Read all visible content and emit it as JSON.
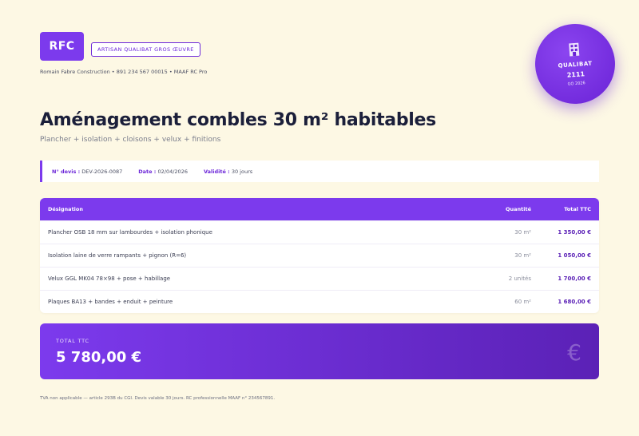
{
  "header": {
    "logo_text": "RFC",
    "qualification_badge": "ARTISAN QUALIBAT GROS ŒUVRE",
    "company_line": "Romain Fabre Construction • 891 234 567 00015 • MAAF RC Pro"
  },
  "seal": {
    "icon": "building-emblem-icon",
    "title": "QUALIBAT",
    "number": "2111",
    "subtitle": "GO 2026"
  },
  "document": {
    "title": "Aménagement combles 30 m² habitables",
    "subtitle": "Plancher + isolation + cloisons + velux + finitions"
  },
  "info": {
    "number_label": "N° devis :",
    "number_value": "DEV-2026-0087",
    "date_label": "Date :",
    "date_value": "02/04/2026",
    "validity_label": "Validité :",
    "validity_value": "30 jours"
  },
  "table": {
    "headers": [
      "Désignation",
      "Quantité",
      "Total TTC"
    ],
    "rows": [
      {
        "designation": "Plancher OSB 18 mm sur lambourdes + isolation phonique",
        "quantity": "30 m²",
        "total": "1 350,00 €"
      },
      {
        "designation": "Isolation laine de verre rampants + pignon (R=6)",
        "quantity": "30 m²",
        "total": "1 050,00 €"
      },
      {
        "designation": "Velux GGL MK04 78×98 + pose + habillage",
        "quantity": "2 unités",
        "total": "1 700,00 €"
      },
      {
        "designation": "Plaques BA13 + bandes + enduit + peinture",
        "quantity": "60 m²",
        "total": "1 680,00 €"
      }
    ]
  },
  "total": {
    "label": "TOTAL TTC",
    "amount": "5 780,00 €",
    "icon": "euro-icon"
  },
  "footer": {
    "note": "TVA non applicable — article 293B du CGI. Devis valable 30 jours. RC professionnelle MAAF n° 234567891."
  },
  "colors": {
    "accent": "#7c3aed",
    "accent_dark": "#5b21b6",
    "background": "#fdf8e4"
  }
}
